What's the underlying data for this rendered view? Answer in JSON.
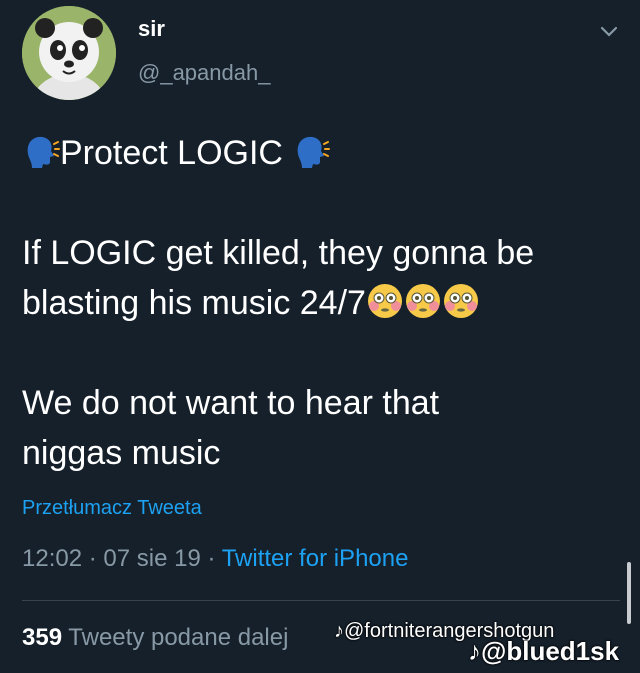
{
  "user": {
    "display_name": "sir",
    "handle": "@_apandah_"
  },
  "tweet": {
    "line1": "Protect LOGIC",
    "line2a": "If LOGIC get killed, they gonna be",
    "line2b": "blasting his music 24/7",
    "line3a": "We do not want to hear that",
    "line3b": "niggas music",
    "translate_label": "Przetłumacz Tweeta"
  },
  "meta": {
    "time": "12:02",
    "sep1": " · ",
    "date": "07 sie 19",
    "sep2": " · ",
    "source": "Twitter for iPhone"
  },
  "stats": {
    "retweets_count": "359",
    "retweets_label": "Tweety podane dalej"
  },
  "watermarks": {
    "tiktok_handle": "@fortniterangershotgun",
    "tiktok_user": "@blued1sk"
  },
  "icons": {
    "speaking_head": "speaking-head-icon",
    "flushed_face": "flushed-face-icon",
    "more": "chevron-down-icon"
  },
  "colors": {
    "background": "#15202b",
    "link": "#1da1f2",
    "secondary_text": "#8899a6"
  }
}
